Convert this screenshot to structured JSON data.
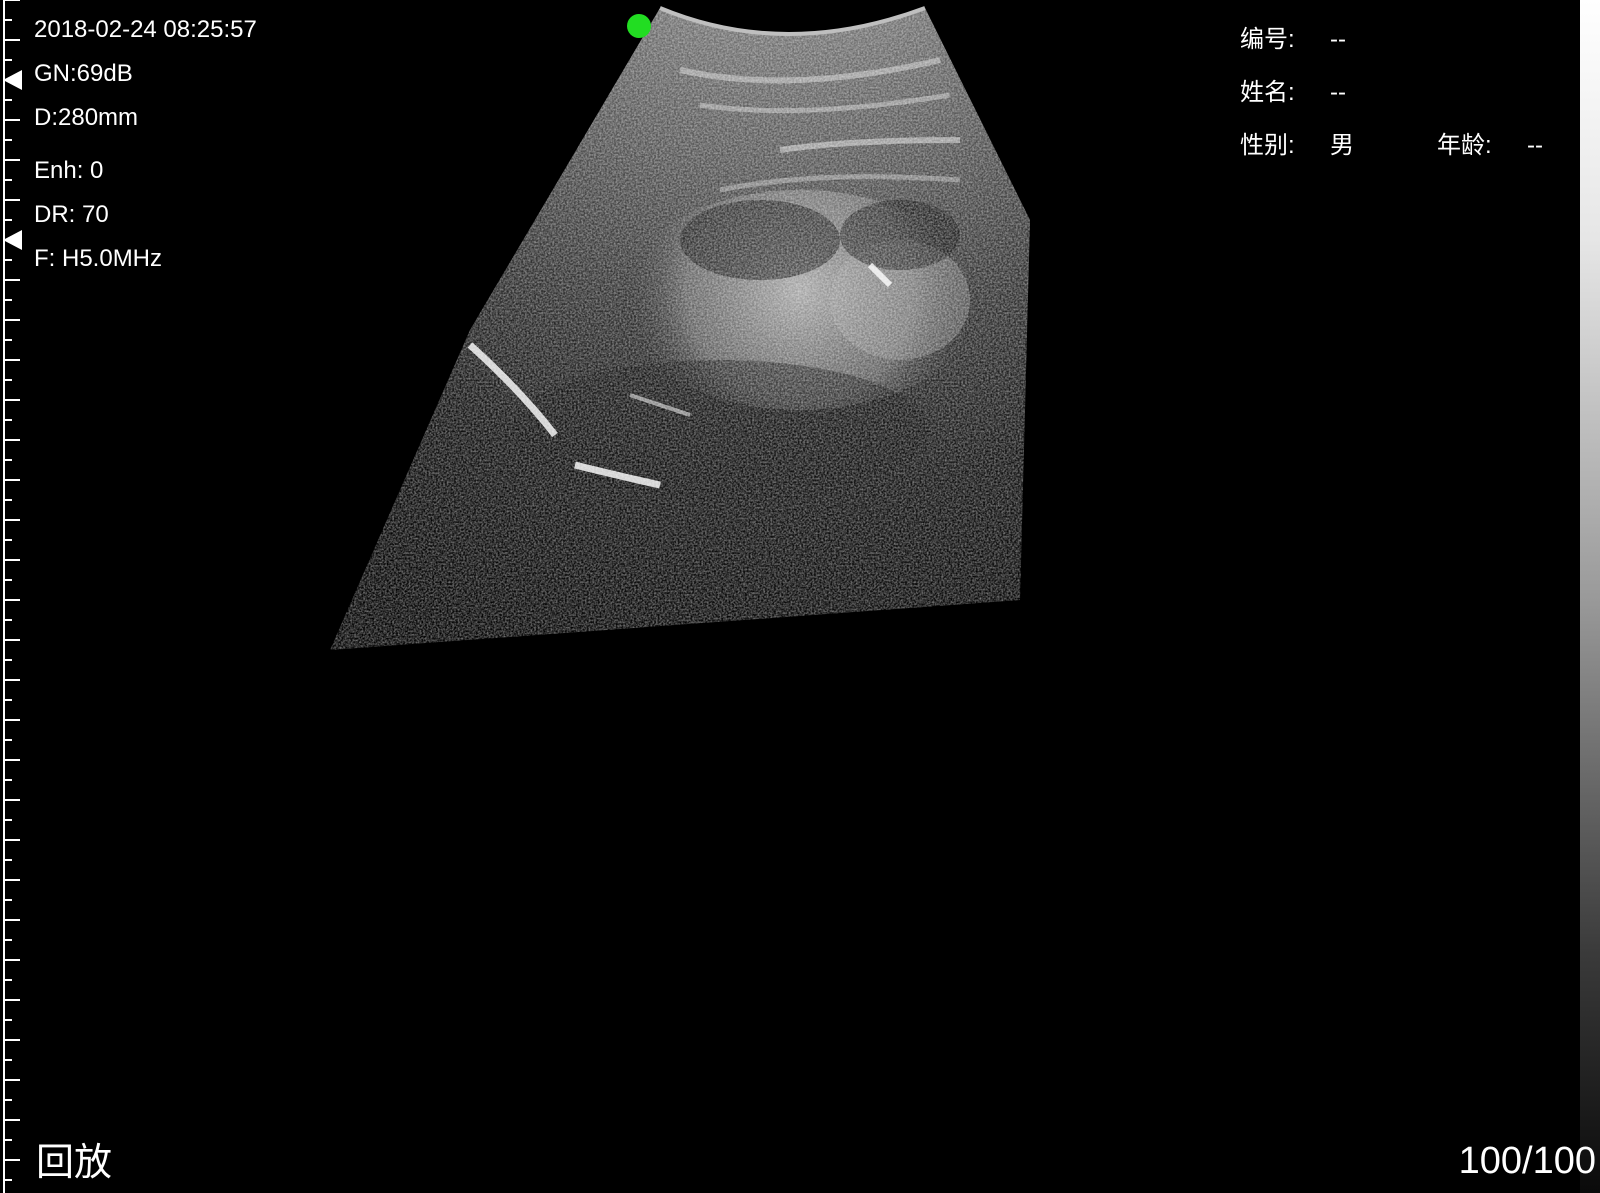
{
  "scan_params": {
    "datetime": "2018-02-24 08:25:57",
    "gain": "GN:69dB",
    "depth": "D:280mm",
    "enhancement": "Enh: 0",
    "dynamic_range": "DR: 70",
    "frequency": "F: H5.0MHz"
  },
  "patient_info": {
    "id_label": "编号:",
    "id_value": "--",
    "name_label": "姓名:",
    "name_value": "--",
    "sex_label": "性别:",
    "sex_value": "男",
    "age_label": "年龄:",
    "age_value": "--"
  },
  "footer": {
    "mode_label": "回放",
    "frame_counter": "100/100"
  },
  "colors": {
    "background": "#000000",
    "probe_orientation_marker": "#22dd22",
    "text": "#ffffff"
  },
  "icons": {
    "probe_marker": "probe-orientation-dot",
    "focus_markers": "focus-triangle-icon"
  }
}
